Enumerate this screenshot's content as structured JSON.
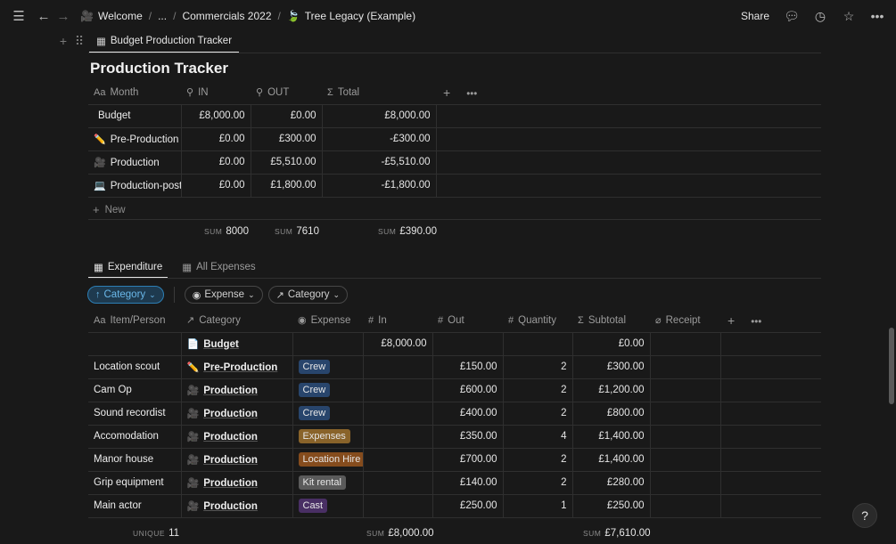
{
  "topbar": {
    "breadcrumbs": [
      {
        "icon": "🎥",
        "label": "Welcome"
      },
      {
        "icon": "",
        "label": "..."
      },
      {
        "icon": "",
        "label": "Commercials 2022"
      },
      {
        "icon": "🍃",
        "label": "Tree Legacy (Example)"
      }
    ],
    "share_label": "Share"
  },
  "view_tab": "Budget Production Tracker",
  "production": {
    "title": "Production Tracker",
    "columns": [
      "Month",
      "IN",
      "OUT",
      "Total"
    ],
    "rows": [
      {
        "icon": "",
        "name": "Budget",
        "in": "£8,000.00",
        "out": "£0.00",
        "total": "£8,000.00"
      },
      {
        "icon": "✏️",
        "name": "Pre-Production",
        "in": "£0.00",
        "out": "£300.00",
        "total": "-£300.00"
      },
      {
        "icon": "🎥",
        "name": "Production",
        "in": "£0.00",
        "out": "£5,510.00",
        "total": "-£5,510.00"
      },
      {
        "icon": "💻",
        "name": "Production-post",
        "in": "£0.00",
        "out": "£1,800.00",
        "total": "-£1,800.00"
      }
    ],
    "new_label": "New",
    "sums": {
      "label": "SUM",
      "in": "8000",
      "out": "7610",
      "total": "£390.00"
    }
  },
  "expenditure": {
    "tabs": [
      "Expenditure",
      "All Expenses"
    ],
    "filters": {
      "sort": "Category",
      "expense": "Expense",
      "category": "Category"
    },
    "columns": [
      "Item/Person",
      "Category",
      "Expense",
      "In",
      "Out",
      "Quantity",
      "Subtotal",
      "Receipt"
    ],
    "rows": [
      {
        "item": "",
        "cat_icon": "📄",
        "category": "Budget",
        "expense": "",
        "tag_color": "",
        "in": "£8,000.00",
        "out": "",
        "qty": "",
        "subtotal": "£0.00"
      },
      {
        "item": "Location scout",
        "cat_icon": "✏️",
        "category": "Pre-Production",
        "expense": "Crew",
        "tag_color": "#28456c",
        "in": "",
        "out": "£150.00",
        "qty": "2",
        "subtotal": "£300.00"
      },
      {
        "item": "Cam Op",
        "cat_icon": "🎥",
        "category": "Production",
        "expense": "Crew",
        "tag_color": "#28456c",
        "in": "",
        "out": "£600.00",
        "qty": "2",
        "subtotal": "£1,200.00"
      },
      {
        "item": "Sound recordist",
        "cat_icon": "🎥",
        "category": "Production",
        "expense": "Crew",
        "tag_color": "#28456c",
        "in": "",
        "out": "£400.00",
        "qty": "2",
        "subtotal": "£800.00"
      },
      {
        "item": "Accomodation",
        "cat_icon": "🎥",
        "category": "Production",
        "expense": "Expenses",
        "tag_color": "#89632a",
        "in": "",
        "out": "£350.00",
        "qty": "4",
        "subtotal": "£1,400.00"
      },
      {
        "item": "Manor house",
        "cat_icon": "🎥",
        "category": "Production",
        "expense": "Location Hire",
        "tag_color": "#854c1d",
        "in": "",
        "out": "£700.00",
        "qty": "2",
        "subtotal": "£1,400.00"
      },
      {
        "item": "Grip equipment",
        "cat_icon": "🎥",
        "category": "Production",
        "expense": "Kit rental",
        "tag_color": "#5a5a5a",
        "in": "",
        "out": "£140.00",
        "qty": "2",
        "subtotal": "£280.00"
      },
      {
        "item": "Main actor",
        "cat_icon": "🎥",
        "category": "Production",
        "expense": "Cast",
        "tag_color": "#492f64",
        "in": "",
        "out": "£250.00",
        "qty": "1",
        "subtotal": "£250.00"
      }
    ],
    "footer": {
      "unique_label": "UNIQUE",
      "unique": "11",
      "sum_label": "SUM",
      "in_sum": "£8,000.00",
      "subtotal_sum": "£7,610.00"
    }
  },
  "help_label": "?"
}
